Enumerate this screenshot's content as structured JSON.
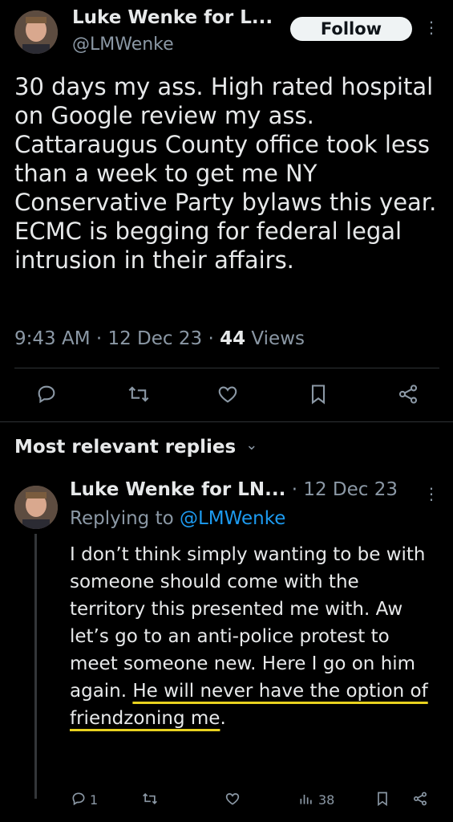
{
  "tweet": {
    "author_name": "Luke Wenke for L...",
    "author_handle": "@LMWenke",
    "follow_label": "Follow",
    "more_glyph": "⋮",
    "text": "30 days my ass.  High rated hospital on Google review my ass.  Cattaraugus County office took less than a week to get me NY Conservative Party bylaws this year.  ECMC is begging for federal legal intrusion in their affairs.",
    "time": "9:43 AM",
    "sep1": "·",
    "date": "12 Dec 23",
    "sep2": "·",
    "views_count": "44",
    "views_label": "Views"
  },
  "actions": {
    "reply_icon": "reply-icon",
    "retweet_icon": "retweet-icon",
    "like_icon": "heart-icon",
    "bookmark_icon": "bookmark-icon",
    "share_icon": "share-icon"
  },
  "replies_section": {
    "title": "Most relevant replies",
    "chevron": "⌄"
  },
  "reply": {
    "author_name": "Luke Wenke for LN...",
    "sep": "·",
    "date": "12 Dec 23",
    "more_glyph": "⋮",
    "replying_to_label": "Replying to",
    "replying_to_handle": "@LMWenke",
    "text_plain": "I don’t think simply wanting to be with someone should come with the territory this presented me with.  Aw let’s go to an anti-police protest to meet someone new.  Here I go on him again. ",
    "text_highlight": "He will never have the option of friendzoning me",
    "text_end": ".",
    "reply_count": "1",
    "views_count": "38"
  },
  "colors": {
    "background": "#000000",
    "text": "#e7e9ea",
    "secondary": "#8b98a5",
    "accent": "#1d9bf0",
    "highlight_underline": "#e8d21f"
  }
}
